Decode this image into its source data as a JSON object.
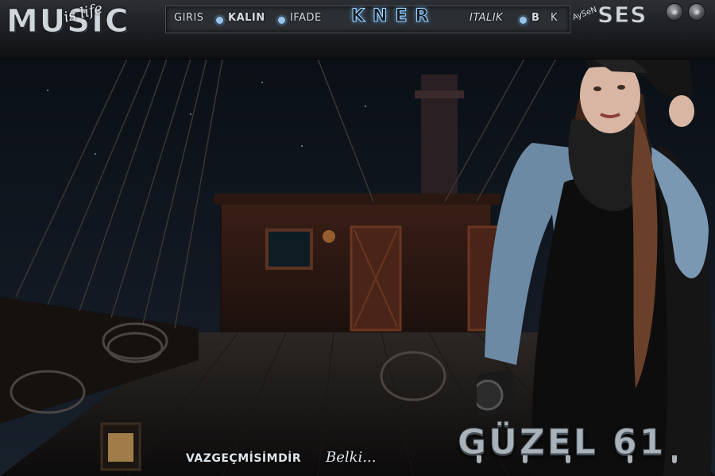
{
  "logo": {
    "main": "MUSIC",
    "sub": "is life"
  },
  "menu": {
    "items": [
      {
        "label": "GIRIS",
        "style": "normal"
      },
      {
        "label": "KALIN",
        "style": "bold"
      },
      {
        "label": "IFADE",
        "style": "normal"
      },
      {
        "label": "ITALIK",
        "style": "italic"
      },
      {
        "label": "B",
        "style": "bold"
      },
      {
        "label": "K",
        "style": "normal"
      }
    ],
    "brand": "KNER"
  },
  "right_logo": {
    "text": "AySeN",
    "mark": "SES"
  },
  "window_buttons": [
    "minimize",
    "close"
  ],
  "footer": {
    "text": "VAZGEÇMİSİMDİR",
    "script": "Belki..."
  },
  "title": "GÜZEL 61",
  "colors": {
    "accent": "#9fd6ff",
    "menu_bg": "#2b2e32",
    "topbar_bg": "#1a1c1f"
  }
}
